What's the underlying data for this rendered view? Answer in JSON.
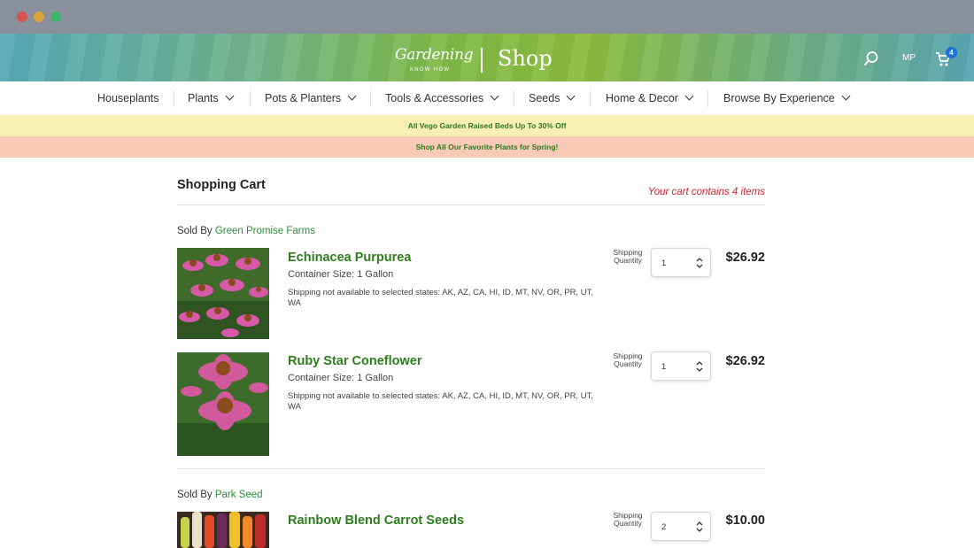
{
  "header": {
    "brand_script": "Gardening",
    "brand_sub": "KNOW HOW",
    "brand_shop": "Shop",
    "user_initials": "MP",
    "cart_badge": "4"
  },
  "nav": {
    "items": [
      {
        "label": "Houseplants"
      },
      {
        "label": "Plants"
      },
      {
        "label": "Pots & Planters"
      },
      {
        "label": "Tools & Accessories"
      },
      {
        "label": "Seeds"
      },
      {
        "label": "Home & Decor"
      },
      {
        "label": "Browse By Experience"
      }
    ]
  },
  "banners": [
    "All Vego Garden Raised Beds Up To 30% Off",
    "Shop All Our Favorite Plants for Spring!"
  ],
  "cart": {
    "title": "Shopping Cart",
    "count_text": "Your cart contains 4 items",
    "sold_by_label": "Sold By",
    "qty_label": "Shipping Quantity",
    "groups": [
      {
        "vendor": "Green Promise Farms",
        "items": [
          {
            "name": "Echinacea Purpurea",
            "container": "Container Size: 1 Gallon",
            "note": "Shipping not available to selected states: AK, AZ, CA, HI, ID, MT, NV, OR, PR, UT, WA",
            "qty": "1",
            "price": "$26.92"
          },
          {
            "name": "Ruby Star Coneflower",
            "container": "Container Size: 1 Gallon",
            "note": "Shipping not available to selected states: AK, AZ, CA, HI, ID, MT, NV, OR, PR, UT, WA",
            "qty": "1",
            "price": "$26.92"
          }
        ]
      },
      {
        "vendor": "Park Seed",
        "items": [
          {
            "name": "Rainbow Blend Carrot Seeds",
            "qty": "2",
            "price": "$10.00"
          }
        ]
      }
    ]
  }
}
